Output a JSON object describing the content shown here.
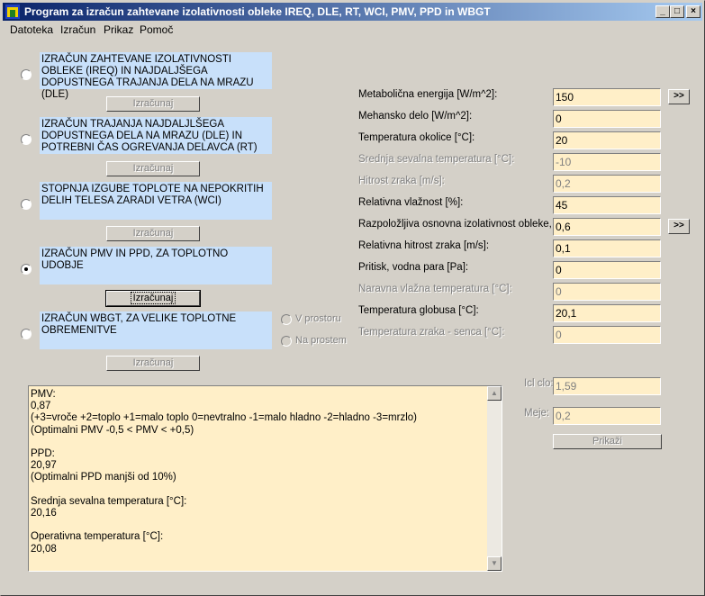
{
  "window": {
    "title": "Program za izračun zahtevane izolativnosti obleke IREQ, DLE, RT, WCI, PMV, PPD in WBGT",
    "minimize": "_",
    "maximize": "□",
    "close": "×"
  },
  "menu": [
    "Datoteka",
    "Izračun",
    "Prikaz",
    "Pomoč"
  ],
  "options": [
    {
      "text": "IZRAČUN ZAHTEVANE IZOLATIVNOSTI OBLEKE (IREQ) IN NAJDALJŠEGA DOPUSTNEGA TRAJANJA DELA NA MRAZU (DLE)",
      "selected": false,
      "button": "Izračunaj",
      "button_enabled": false
    },
    {
      "text": "IZRAČUN TRAJANJA NAJDALJLŠEGA DOPUSTNEGA DELA NA MRAZU (DLE) IN POTREBNI ČAS OGREVANJA DELAVCA (RT)",
      "selected": false,
      "button": "Izračunaj",
      "button_enabled": false
    },
    {
      "text": "STOPNJA IZGUBE TOPLOTE NA NEPOKRITIH DELIH TELESA ZARADI VETRA (WCI)",
      "selected": false,
      "button": "Izračunaj",
      "button_enabled": false
    },
    {
      "text": "IZRAČUN PMV IN PPD, ZA TOPLOTNO UDOBJE",
      "selected": true,
      "button": "Izračunaj",
      "button_enabled": true
    },
    {
      "text": "IZRAČUN WBGT, ZA VELIKE TOPLOTNE OBREMENITVE",
      "selected": false,
      "button": "Izračunaj",
      "button_enabled": false
    }
  ],
  "wbgt_suboptions": [
    "V prostoru",
    "Na prostem"
  ],
  "params": [
    {
      "label": "Metabolična energija [W/m^2]:",
      "value": "150",
      "enabled": true,
      "more": ">>"
    },
    {
      "label": "Mehansko delo [W/m^2]:",
      "value": "0",
      "enabled": true
    },
    {
      "label": "Temperatura okolice [°C]:",
      "value": "20",
      "enabled": true
    },
    {
      "label": "Srednja sevalna temperatura [°C]:",
      "value": "-10",
      "enabled": false
    },
    {
      "label": "Hitrost zraka [m/s]:",
      "value": "0,2",
      "enabled": false
    },
    {
      "label": "Relativna vlažnost [%]:",
      "value": "45",
      "enabled": true
    },
    {
      "label": "Razpoložljiva osnovna izolativnost obleke, Ic",
      "value": "0,6",
      "enabled": true,
      "more": ">>"
    },
    {
      "label": "Relativna hitrost zraka [m/s]:",
      "value": "0,1",
      "enabled": true
    },
    {
      "label": "Pritisk, vodna para [Pa]:",
      "value": "0",
      "enabled": true
    },
    {
      "label": "Naravna vlažna temperatura [°C]:",
      "value": "0",
      "enabled": false
    },
    {
      "label": "Temperatura globusa [°C]:",
      "value": "20,1",
      "enabled": true
    },
    {
      "label": "Temperatura zraka - senca  [°C]:",
      "value": "0",
      "enabled": false
    }
  ],
  "icl": {
    "label": "Icl clo:",
    "value": "1,59"
  },
  "meje": {
    "label": "Meje:",
    "value": "0,2"
  },
  "prikazi": "Prikaži",
  "output": [
    "PMV:",
    "0,87",
    "(+3=vroče +2=toplo +1=malo toplo 0=nevtralno -1=malo hladno -2=hladno -3=mrzlo)",
    "(Optimalni PMV -0,5 < PMV < +0,5)",
    "",
    "PPD:",
    "20,97",
    "(Optimalni PPD manjši od 10%)",
    "",
    "Srednja sevalna temperatura [°C]:",
    "20,16",
    "",
    "Operativna temperatura [°C]:",
    "20,08"
  ]
}
